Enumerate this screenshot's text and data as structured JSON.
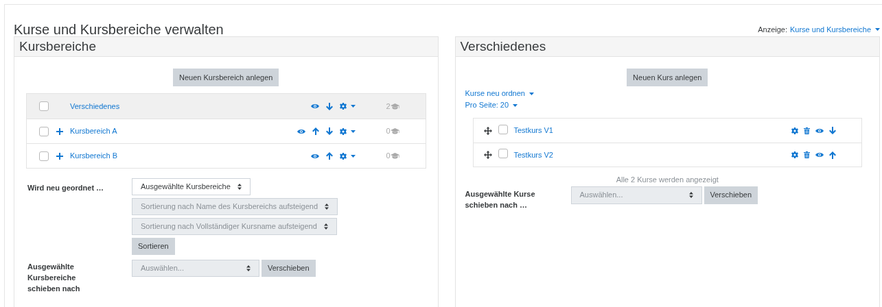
{
  "page_title": "Kurse und Kursbereiche verwalten",
  "view": {
    "label": "Anzeige:",
    "value": "Kurse und Kursbereiche"
  },
  "categories_panel": {
    "title": "Kursbereiche",
    "create_button": "Neuen Kursbereich anlegen",
    "items": [
      {
        "name": "Verschiedenes",
        "selected": true,
        "checked": false,
        "expandable": false,
        "actions": [
          {
            "kind": "eye"
          },
          {
            "kind": "down"
          },
          {
            "kind": "gear"
          }
        ],
        "count": "2"
      },
      {
        "name": "Kursbereich A",
        "selected": false,
        "checked": false,
        "expandable": true,
        "actions": [
          {
            "kind": "eye"
          },
          {
            "kind": "up"
          },
          {
            "kind": "down"
          },
          {
            "kind": "gear"
          }
        ],
        "count": "0"
      },
      {
        "name": "Kursbereich B",
        "selected": false,
        "checked": false,
        "expandable": true,
        "actions": [
          {
            "kind": "eye"
          },
          {
            "kind": "up"
          },
          {
            "kind": "gear"
          }
        ],
        "count": "0"
      }
    ],
    "resort": {
      "label": "Wird neu geordnet …",
      "selects": [
        {
          "value": "Ausgewählte Kursbereiche",
          "disabled": false
        },
        {
          "value": "Sortierung nach Name des Kursbereichs aufsteigend",
          "disabled": true
        },
        {
          "value": "Sortierung nach Vollständiger Kursname aufsteigend",
          "disabled": true
        }
      ],
      "button": "Sortieren"
    },
    "move": {
      "label": "Ausgewählte Kursbereiche schieben nach",
      "placeholder": "Auswählen...",
      "button": "Verschieben"
    }
  },
  "courses_panel": {
    "title": "Verschiedenes",
    "create_button": "Neuen Kurs anlegen",
    "sort_menu": "Kurse neu ordnen",
    "per_page": "Pro Seite: 20",
    "items": [
      {
        "name": "Testkurs V1",
        "checked": false,
        "actions": [
          {
            "kind": "gear"
          },
          {
            "kind": "trash"
          },
          {
            "kind": "eye"
          },
          {
            "kind": "down"
          }
        ]
      },
      {
        "name": "Testkurs V2",
        "checked": false,
        "actions": [
          {
            "kind": "gear"
          },
          {
            "kind": "trash"
          },
          {
            "kind": "eye"
          },
          {
            "kind": "up"
          }
        ]
      }
    ],
    "summary": "Alle 2 Kurse werden angezeigt",
    "move": {
      "label": "Ausgewählte Kurse schieben nach …",
      "placeholder": "Auswählen...",
      "button": "Verschieben"
    }
  }
}
